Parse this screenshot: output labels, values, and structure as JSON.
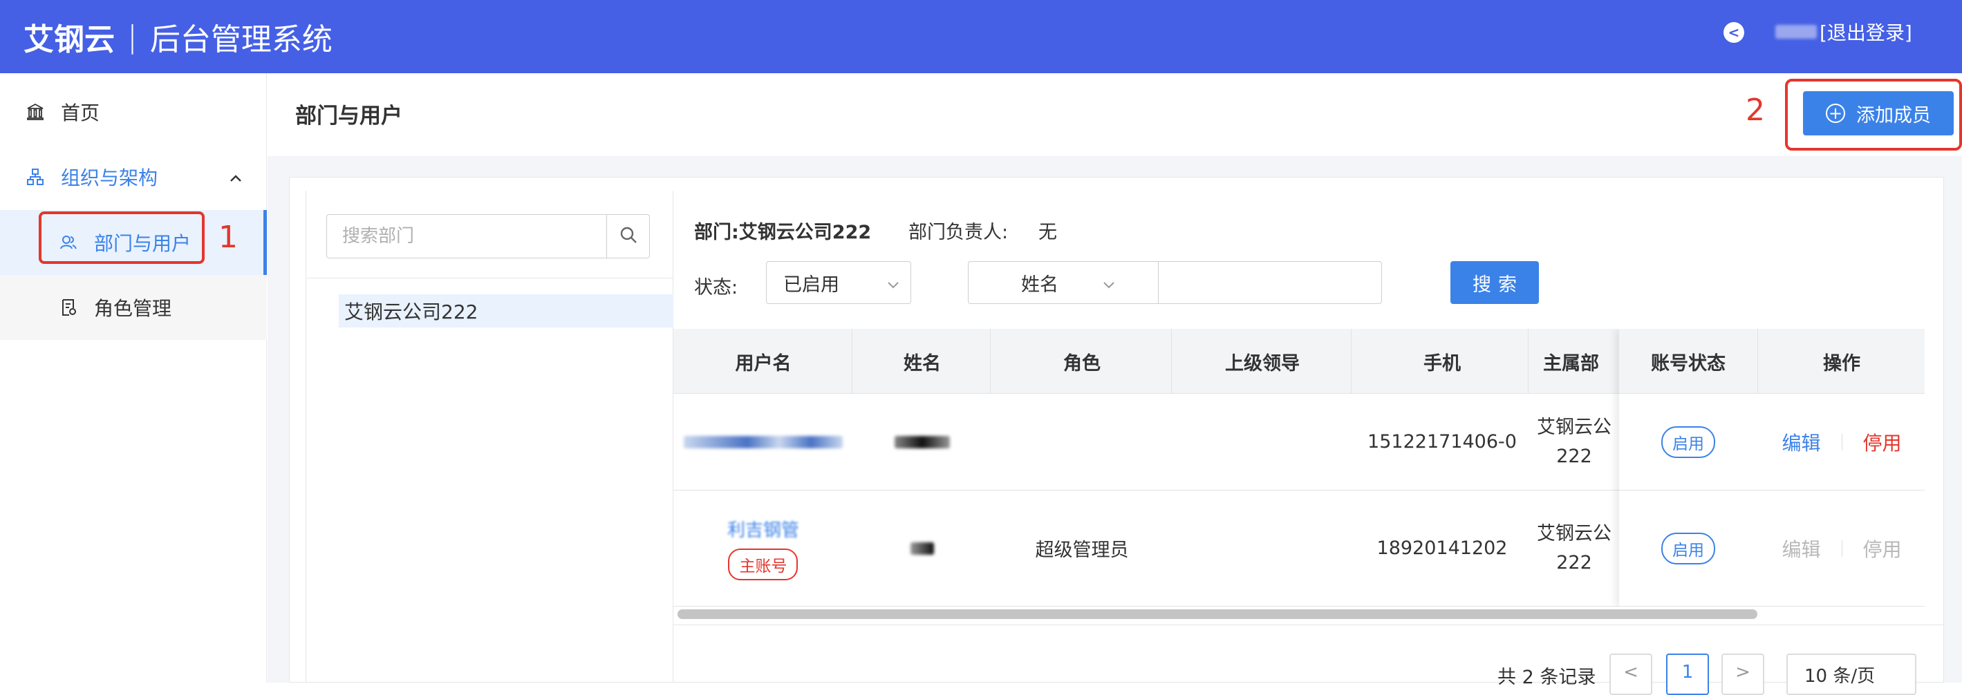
{
  "header": {
    "brand": "艾钢云",
    "separator": "|",
    "system": "后台管理系统",
    "back_glyph": "<",
    "logout": "[退出登录]"
  },
  "sidebar": {
    "home": "首页",
    "org": "组织与架构",
    "dept_users": "部门与用户",
    "roles": "角色管理"
  },
  "annotations": {
    "mark1": "1",
    "mark2": "2"
  },
  "page": {
    "title": "部门与用户",
    "add_member": "添加成员"
  },
  "tree": {
    "search_placeholder": "搜索部门",
    "node": "艾钢云公司222"
  },
  "dept_info": {
    "dept": "部门:艾钢云公司222",
    "leader_label": "部门负责人:",
    "leader_value": "无"
  },
  "filters": {
    "status_label": "状态:",
    "status_value": "已启用",
    "field_value": "姓名",
    "search_button": "搜索"
  },
  "table": {
    "columns": [
      "用户名",
      "姓名",
      "角色",
      "上级领导",
      "手机",
      "主属部",
      "账号状态",
      "操作"
    ],
    "rows": [
      {
        "role": "",
        "supervisor": "",
        "phone": "15122171406-0",
        "dept_line1": "艾钢云公",
        "dept_line2": "222",
        "status": "启用",
        "edit": "编辑",
        "stop": "停用"
      },
      {
        "username_partial": "利吉钢管",
        "tag": "主账号",
        "role": "超级管理员",
        "supervisor": "",
        "phone": "18920141202",
        "dept_line1": "艾钢云公",
        "dept_line2": "222",
        "status": "启用",
        "edit": "编辑",
        "stop": "停用"
      }
    ]
  },
  "pagination": {
    "total": "共 2 条记录",
    "prev": "<",
    "page": "1",
    "next": ">",
    "page_size": "10 条/页"
  },
  "colors": {
    "header_bg": "#4560e5",
    "accent": "#3b82e8",
    "annotation_red": "#e3362d",
    "danger": "#e3362d"
  }
}
